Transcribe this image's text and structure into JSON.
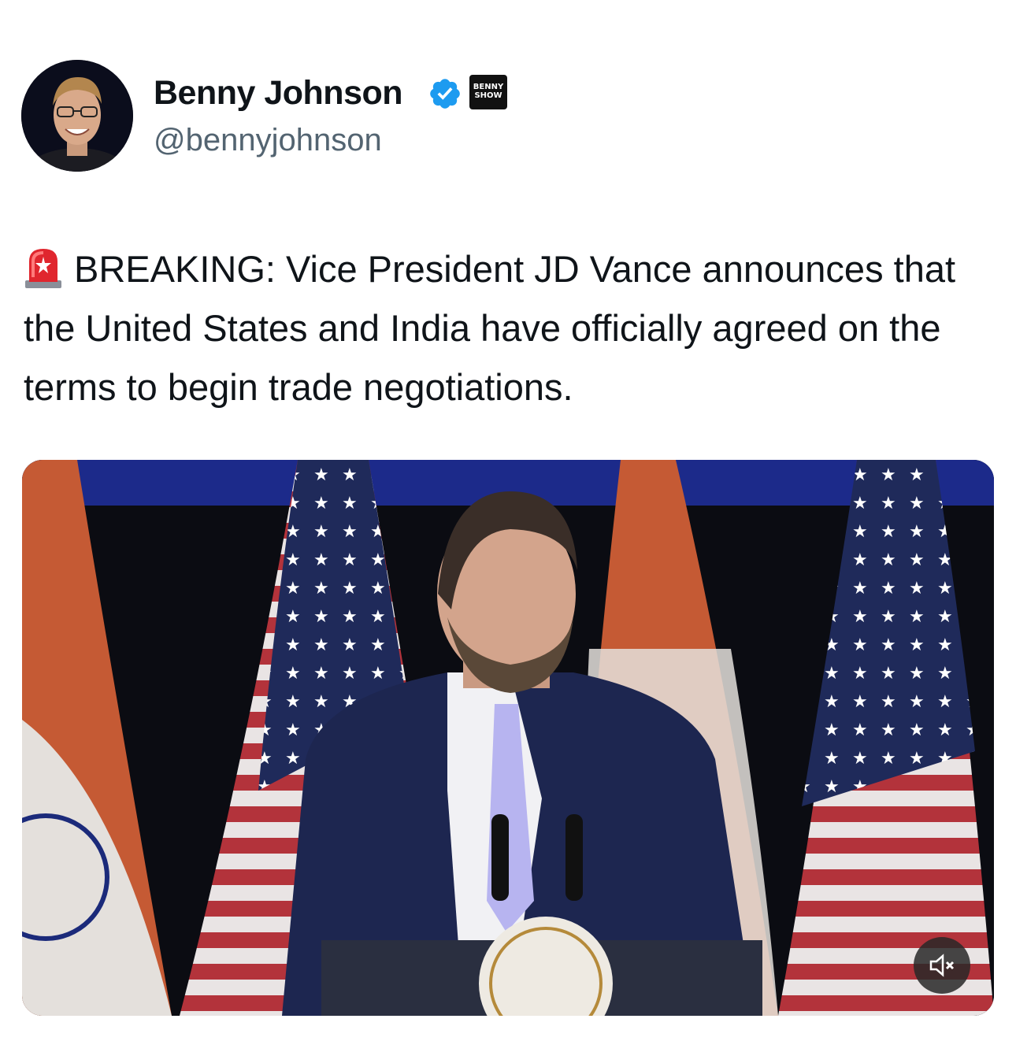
{
  "author": {
    "display_name": "Benny Johnson",
    "handle": "@bennyjohnson",
    "verified_icon": "verified-badge-icon",
    "affiliate_badge_text": "BENNY SHOW"
  },
  "tweet": {
    "emoji": "rotating-light-siren-icon",
    "text": "BREAKING: Vice President JD Vance announces that the United States and India have officially agreed on the terms to begin trade negotiations."
  },
  "media": {
    "type": "video",
    "description_icon": "video-thumbnail",
    "mute_icon": "muted-speaker-icon"
  },
  "colors": {
    "verified_blue": "#1d9bf0",
    "handle_gray": "#536471",
    "text": "#0f1419"
  }
}
